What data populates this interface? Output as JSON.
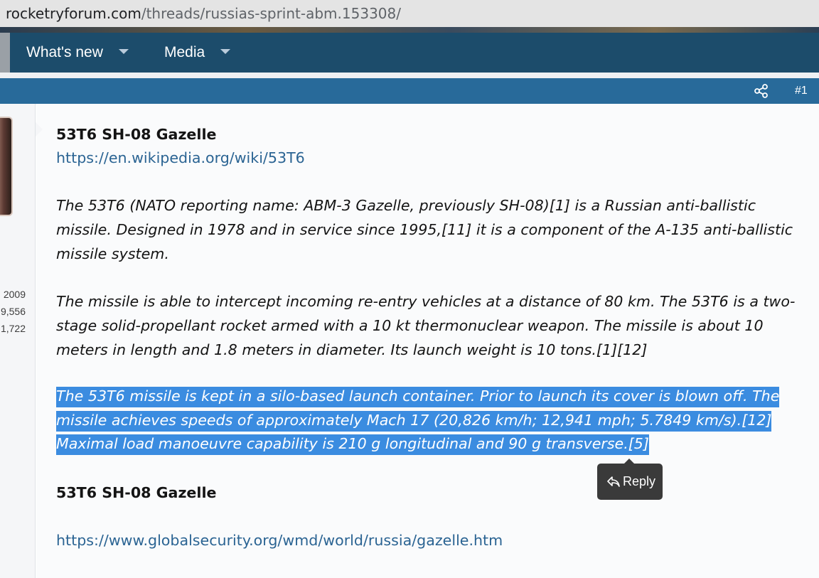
{
  "browser": {
    "url_domain": "rocketryforum.com",
    "url_path": "/threads/russias-sprint-abm.153308/"
  },
  "nav": {
    "items": [
      {
        "label": "What's new"
      },
      {
        "label": "Media"
      }
    ]
  },
  "post": {
    "number": "#1"
  },
  "user": {
    "stats": [
      "2009",
      "9,556",
      "1,722"
    ]
  },
  "content": {
    "heading1": "53T6 SH-08 Gazelle",
    "link1": "https://en.wikipedia.org/wiki/53T6",
    "p1": [
      "The 53T6 (NATO reporting name: ABM-3 Gazelle, previously SH-08)[1] is a Russian anti-ballistic",
      "missile. Designed in 1978 and in service since 1995,[11] it is a component of the A-135 anti-ballistic",
      "missile system."
    ],
    "p2": [
      "The missile is able to intercept incoming re-entry vehicles at a distance of 80 km. The 53T6 is a two-",
      "stage solid-propellant rocket armed with a 10 kt thermonuclear weapon. The missile is about 10",
      "meters in length and 1.8 meters in diameter. Its launch weight is 10 tons.[1][12]"
    ],
    "p3": [
      "The 53T6 missile is kept in a silo-based launch container. Prior to launch its cover is blown off. The",
      "missile achieves speeds of approximately Mach 17 (20,826 km/h; 12,941 mph; 5.7849 km/s).[12]",
      "Maximal load manoeuvre capability is 210 g longitudinal and 90 g transverse.[5]"
    ],
    "heading2": "53T6 SH-08 Gazelle",
    "link2": "https://www.globalsecurity.org/wmd/world/russia/gazelle.htm"
  },
  "tooltip": {
    "reply_label": "Reply"
  },
  "colors": {
    "nav_bg": "#1c4c6b",
    "post_bar": "#286a9a",
    "link": "#2b6493",
    "selection": "#3b8ce0"
  },
  "icons": [
    "share-icon",
    "reply-icon",
    "caret-down-icon"
  ]
}
